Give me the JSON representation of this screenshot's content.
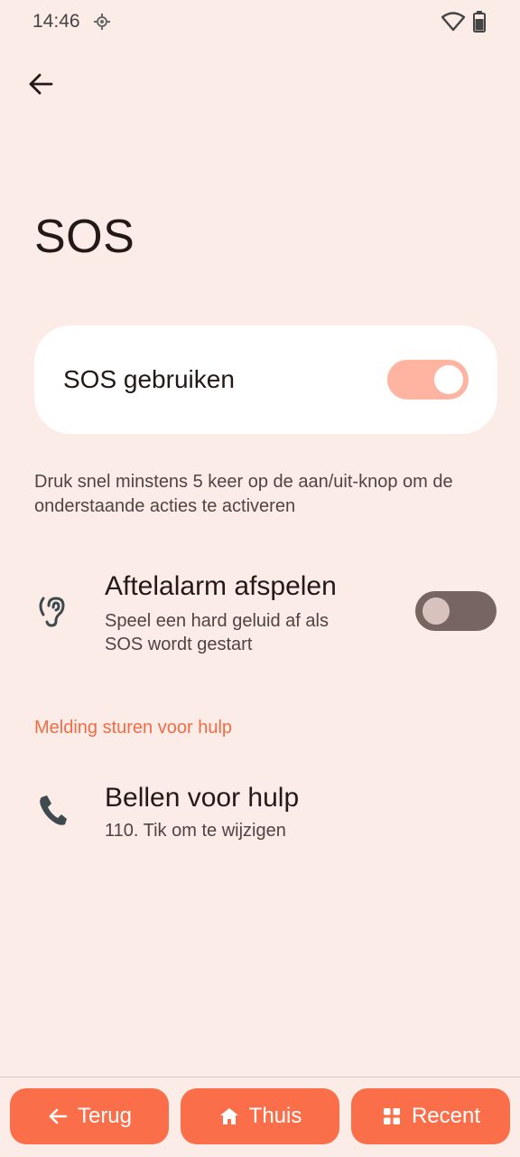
{
  "status_bar": {
    "time": "14:46"
  },
  "page": {
    "title": "SOS"
  },
  "main_toggle": {
    "label": "SOS gebruiken",
    "state": "on"
  },
  "description": "Druk snel minstens 5 keer op de aan/uit-knop om de onderstaande acties te activeren",
  "alarm_setting": {
    "title": "Aftelalarm afspelen",
    "subtitle_line1": "Speel een hard geluid af als",
    "subtitle_line2": "SOS wordt gestart",
    "state": "off"
  },
  "section": {
    "header": "Melding sturen voor hulp"
  },
  "call_setting": {
    "title": "Bellen voor hulp",
    "subtitle": "110. Tik om te wijzigen"
  },
  "nav": {
    "back_label": "Terug",
    "home_label": "Thuis",
    "recent_label": "Recent"
  },
  "colors": {
    "background": "#fcece8",
    "accent": "#fa6e49",
    "switch_on": "#ffb4a2",
    "switch_off": "#776562",
    "section_header": "#f26c46"
  }
}
